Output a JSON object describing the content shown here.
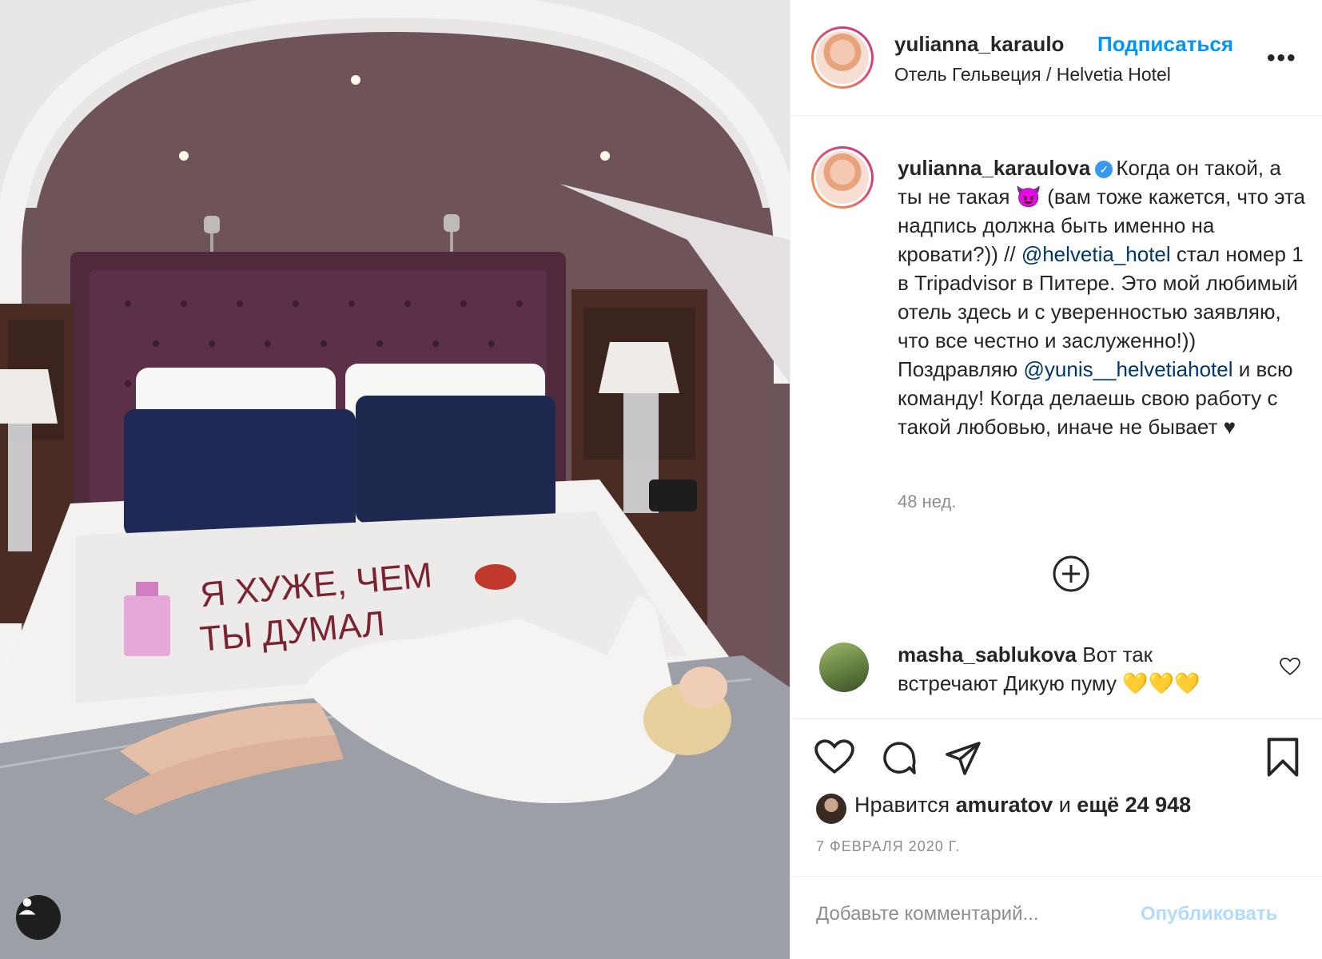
{
  "post": {
    "header": {
      "username": "yulianna_karaulo",
      "follow_label": "Подписаться",
      "location": "Отель Гельвеция / Helvetia Hotel",
      "more_label": "•••"
    },
    "caption": {
      "username": "yulianna_karaulova",
      "verified": true,
      "text_1": "Когда он такой, а ты не такая ",
      "emoji_1": "😈",
      "text_2": " (вам тоже кажется, что эта надпись должна быть именно на кровати?)) // ",
      "mention_1": "@helvetia_hotel",
      "text_3": " стал номер 1 в Tripadvisor в Питере. Это мой любимый отель здесь и с уверенностью заявляю, что все честно и заслуженно!)) Поздравляю ",
      "mention_2": "@yunis__helvetiahotel",
      "text_4": " и всю команду! Когда делаешь свою работу с такой любовью, иначе не бывает ",
      "heart": "♥"
    },
    "time_ago": "48 нед.",
    "comment": {
      "username": "masha_sablukova",
      "text": " Вот так встречают Дикую пуму ",
      "emojis": "💛💛💛"
    },
    "likes": {
      "prefix": "Нравится ",
      "user": "amuratov",
      "middle": " и ",
      "count": "ещё 24 948"
    },
    "date": "7 ФЕВРАЛЯ 2020 Г.",
    "comment_box": {
      "placeholder": "Добавьте комментарий...",
      "publish_label": "Опубликовать"
    }
  },
  "photo": {
    "sheet_text_line1": "Я ХУЖЕ, ЧЕМ",
    "sheet_text_line2": "ТЫ ДУМАЛ"
  },
  "colors": {
    "accent": "#0095f6",
    "mention": "#00376b",
    "muted": "#8e8e8e",
    "wall": "#6d5358",
    "headboard": "#5a2e43",
    "pillow_navy": "#1e2a55"
  },
  "icons": [
    "heart-icon",
    "comment-icon",
    "share-icon",
    "bookmark-icon",
    "plus-circle-icon",
    "user-tag-icon",
    "verified-icon",
    "more-icon"
  ]
}
